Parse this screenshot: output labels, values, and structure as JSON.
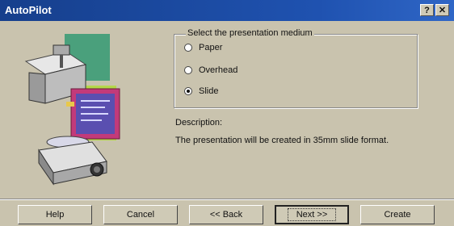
{
  "window": {
    "title": "AutoPilot",
    "help_glyph": "?",
    "close_glyph": "✕"
  },
  "group": {
    "title": "Select the presentation medium",
    "options": [
      {
        "label": "Paper",
        "checked": false
      },
      {
        "label": "Overhead",
        "checked": false
      },
      {
        "label": "Slide",
        "checked": true
      }
    ]
  },
  "description": {
    "label": "Description:",
    "text": "The presentation will be created in 35mm slide format."
  },
  "buttons": {
    "help": "Help",
    "cancel": "Cancel",
    "back": "<< Back",
    "next": "Next >>",
    "create": "Create"
  },
  "illustration": {
    "icons": [
      "overhead-projector-icon",
      "slide-document-icon",
      "slide-projector-icon"
    ]
  }
}
